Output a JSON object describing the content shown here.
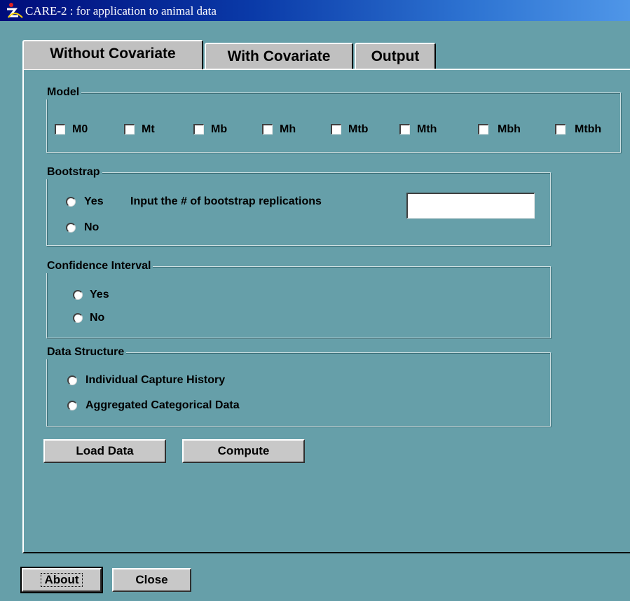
{
  "window": {
    "title": "CARE-2 : for application to animal data",
    "app_icon": "care-app-icon"
  },
  "tabs": [
    {
      "label": "Without Covariate",
      "active": true
    },
    {
      "label": "With Covariate",
      "active": false
    },
    {
      "label": "Output",
      "active": false
    }
  ],
  "model": {
    "title": "Model",
    "options": [
      {
        "label": "M0",
        "checked": false
      },
      {
        "label": "Mt",
        "checked": false
      },
      {
        "label": "Mb",
        "checked": false
      },
      {
        "label": "Mh",
        "checked": false
      },
      {
        "label": "Mtb",
        "checked": false
      },
      {
        "label": "Mth",
        "checked": false
      },
      {
        "label": "Mbh",
        "checked": false
      },
      {
        "label": "Mtbh",
        "checked": false
      }
    ]
  },
  "bootstrap": {
    "title": "Bootstrap",
    "yes_label": "Yes",
    "replications_label": "Input the # of bootstrap replications",
    "replications_value": "",
    "no_label": "No"
  },
  "confidence": {
    "title": "Confidence Interval",
    "yes_label": "Yes",
    "no_label": "No"
  },
  "data_structure": {
    "title": "Data Structure",
    "individual_label": "Individual Capture History",
    "aggregated_label": "Aggregated Categorical Data"
  },
  "actions": {
    "load_label": "Load Data",
    "compute_label": "Compute"
  },
  "footer": {
    "about_label": "About",
    "close_label": "Close"
  }
}
